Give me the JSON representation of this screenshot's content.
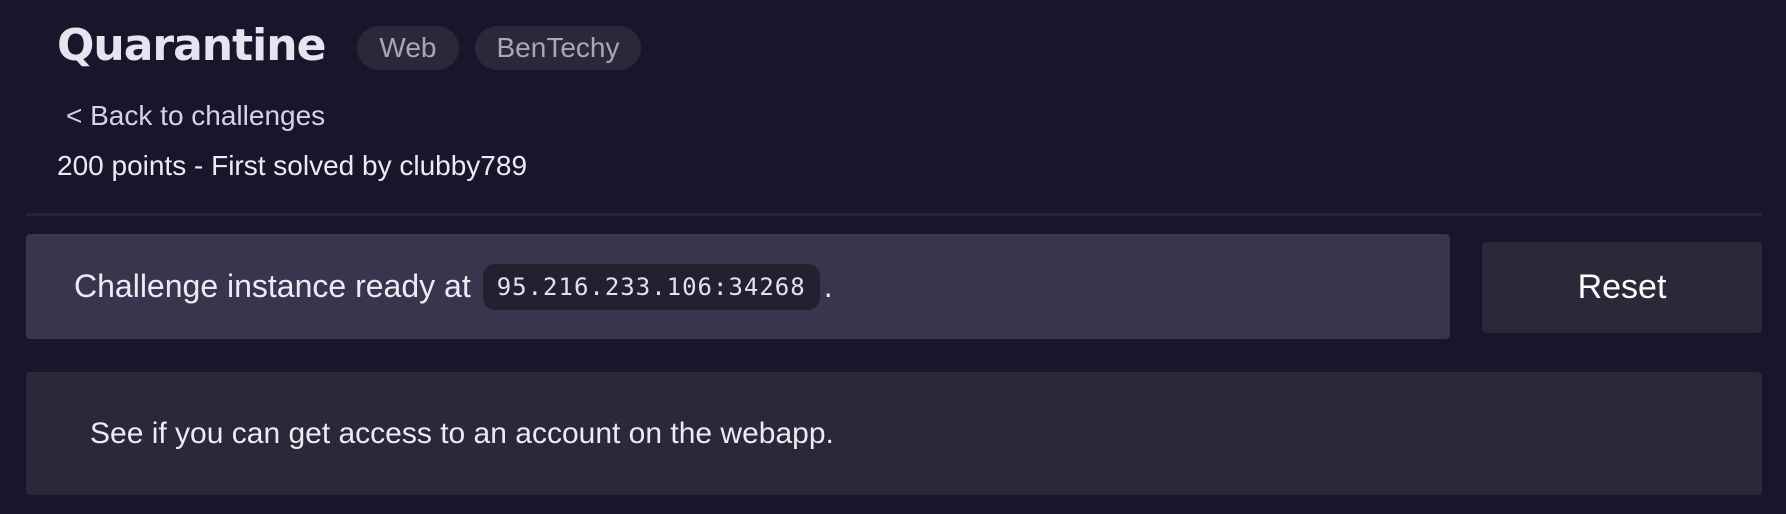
{
  "challenge": {
    "title": "Quarantine",
    "tags": [
      "Web",
      "BenTechy"
    ],
    "back_link": "< Back to challenges",
    "points_line": "200 points - First solved by clubby789"
  },
  "instance": {
    "prefix": "Challenge instance ready at",
    "address": "95.216.233.106:34268",
    "suffix": ".",
    "reset_label": "Reset"
  },
  "description": {
    "text": "See if you can get access to an account on the webapp."
  },
  "colors": {
    "background": "#18162a",
    "instance_box": "#38354d",
    "panel": "#2a2839"
  }
}
